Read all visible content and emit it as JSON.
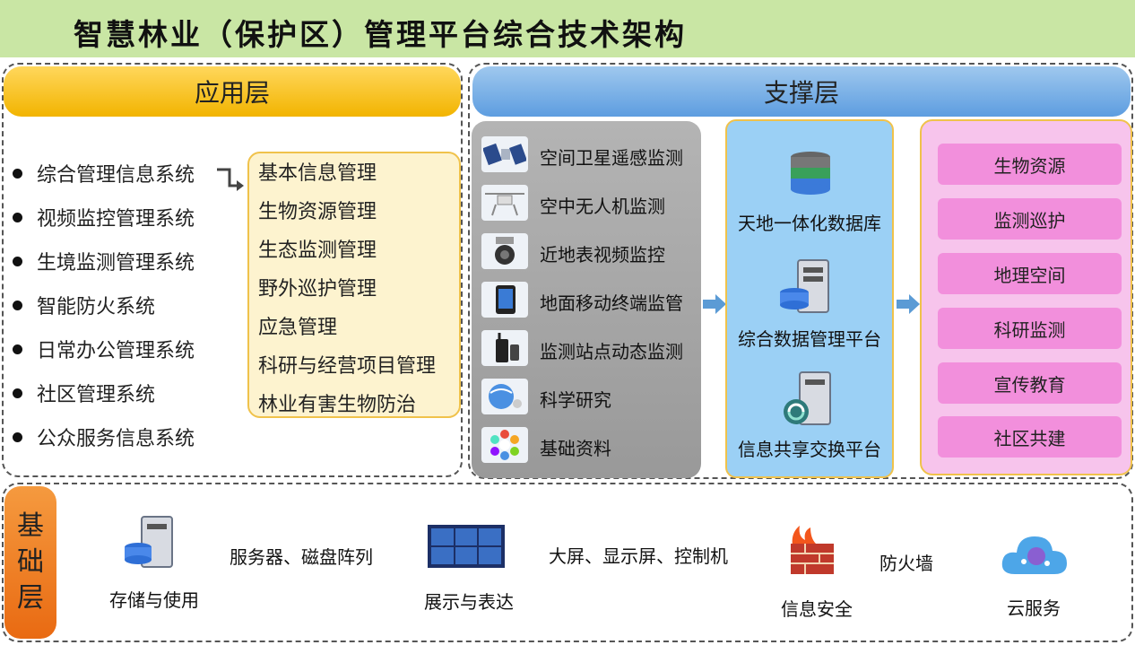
{
  "title": "智慧林业（保护区）管理平台综合技术架构",
  "app_layer": {
    "header": "应用层",
    "systems": [
      "综合管理信息系统",
      "视频监控管理系统",
      "生境监测管理系统",
      "智能防火系统",
      "日常办公管理系统",
      "社区管理系统",
      "公众服务信息系统"
    ],
    "modules": [
      "基本信息管理",
      "生物资源管理",
      "生态监测管理",
      "野外巡护管理",
      "应急管理",
      "科研与经营项目管理",
      "林业有害生物防治"
    ]
  },
  "support_layer": {
    "header": "支撑层",
    "monitoring": [
      {
        "label": "空间卫星遥感监测",
        "icon": "satellite-icon"
      },
      {
        "label": "空中无人机监测",
        "icon": "drone-icon"
      },
      {
        "label": "近地表视频监控",
        "icon": "camera-icon"
      },
      {
        "label": "地面移动终端监管",
        "icon": "tablet-icon"
      },
      {
        "label": "监测站点动态监测",
        "icon": "radio-icon"
      },
      {
        "label": "科学研究",
        "icon": "globe-icon"
      },
      {
        "label": "基础资料",
        "icon": "puzzle-icon"
      }
    ],
    "databases": [
      {
        "label": "天地一体化数据库",
        "icon": "database-icon"
      },
      {
        "label": "综合数据管理平台",
        "icon": "server-icon"
      },
      {
        "label": "信息共享交换平台",
        "icon": "exchange-server-icon"
      }
    ],
    "resources": [
      "生物资源",
      "监测巡护",
      "地理空间",
      "科研监测",
      "宣传教育",
      "社区共建"
    ]
  },
  "base_layer": {
    "tag": [
      "基",
      "础",
      "层"
    ],
    "items": [
      {
        "label": "存储与使用",
        "desc": "服务器、磁盘阵列",
        "icon": "storage-server-icon"
      },
      {
        "label": "展示与表达",
        "desc": "大屏、显示屏、控制机",
        "icon": "video-wall-icon"
      },
      {
        "label": "信息安全",
        "desc": "防火墙",
        "icon": "firewall-icon"
      },
      {
        "label": "云服务",
        "desc": "",
        "icon": "cloud-icon"
      }
    ]
  },
  "colors": {
    "title_bg": "#c9e6a4",
    "app_header": "#f2b400",
    "support_header": "#5d9de0",
    "module_box": "#fdf3cf",
    "db_panel": "#9bd0f5",
    "resource_panel": "#f7c4ec",
    "resource_button": "#f28fdc",
    "base_tag": "#e96a12"
  }
}
